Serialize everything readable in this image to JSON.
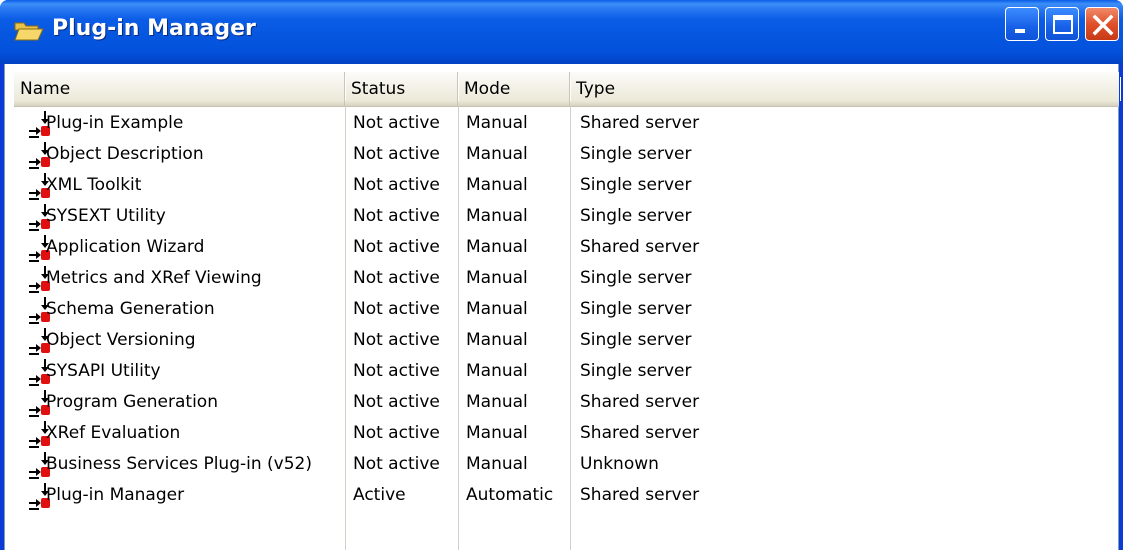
{
  "window": {
    "title": "Plug-in Manager",
    "accent_color": "#0a5de8",
    "icon": "folder-open-icon"
  },
  "columns": [
    "Name",
    "Status",
    "Mode",
    "Type"
  ],
  "rows": [
    {
      "name": "Plug-in Example",
      "status": "Not active",
      "mode": "Manual",
      "type": "Shared server"
    },
    {
      "name": "Object Description",
      "status": "Not active",
      "mode": "Manual",
      "type": "Single server"
    },
    {
      "name": "XML Toolkit",
      "status": "Not active",
      "mode": "Manual",
      "type": "Single server"
    },
    {
      "name": "SYSEXT Utility",
      "status": "Not active",
      "mode": "Manual",
      "type": "Single server"
    },
    {
      "name": "Application Wizard",
      "status": "Not active",
      "mode": "Manual",
      "type": "Shared server"
    },
    {
      "name": "Metrics and XRef Viewing",
      "status": "Not active",
      "mode": "Manual",
      "type": "Single server"
    },
    {
      "name": "Schema Generation",
      "status": "Not active",
      "mode": "Manual",
      "type": "Single server"
    },
    {
      "name": "Object Versioning",
      "status": "Not active",
      "mode": "Manual",
      "type": "Single server"
    },
    {
      "name": "SYSAPI Utility",
      "status": "Not active",
      "mode": "Manual",
      "type": "Single server"
    },
    {
      "name": "Program Generation",
      "status": "Not active",
      "mode": "Manual",
      "type": "Shared server"
    },
    {
      "name": "XRef Evaluation",
      "status": "Not active",
      "mode": "Manual",
      "type": "Shared server"
    },
    {
      "name": "Business Services Plug-in (v52)",
      "status": "Not active",
      "mode": "Manual",
      "type": "Unknown"
    },
    {
      "name": "Plug-in Manager",
      "status": "Active",
      "mode": "Automatic",
      "type": "Shared server"
    }
  ],
  "row_icon": "plugin-arrow-icon"
}
